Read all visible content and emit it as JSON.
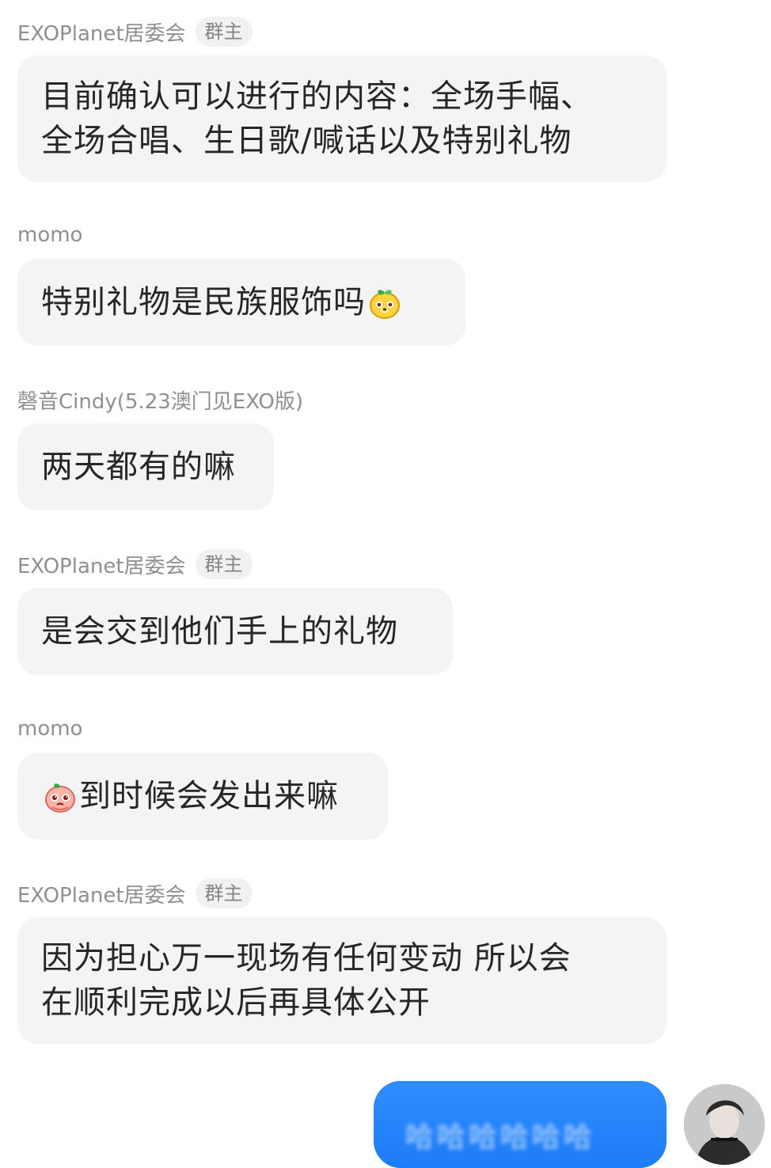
{
  "messages": [
    {
      "sender": "EXOPlanet居委会",
      "badge": "群主",
      "lines": [
        "目前确认可以进行的内容：全场手幅、",
        "全场合唱、生日歌/喊话以及特别礼物"
      ]
    },
    {
      "sender": "momo",
      "text": "特别礼物是民族服饰吗",
      "emoji": "yellow-peach-sticker-icon"
    },
    {
      "sender": "磬音Cindy(5.23澳门见EXO版)",
      "text": "两天都有的嘛"
    },
    {
      "sender": "EXOPlanet居委会",
      "badge": "群主",
      "text": "是会交到他们手上的礼物"
    },
    {
      "sender": "momo",
      "text": "到时候会发出来嘛",
      "emoji": "pink-peach-pleading-sticker-icon"
    },
    {
      "sender": "EXOPlanet居委会",
      "badge": "群主",
      "lines": [
        "因为担心万一现场有任何变动 所以会",
        "在顺利完成以后再具体公开"
      ]
    }
  ],
  "my_message": {
    "blurred_text": "哈哈哈哈哈哈"
  },
  "colors": {
    "bubble_incoming": "#f4f4f4",
    "bubble_outgoing": "#1d7cf7",
    "sender_text": "#8f8f8f",
    "message_text": "#262626"
  }
}
